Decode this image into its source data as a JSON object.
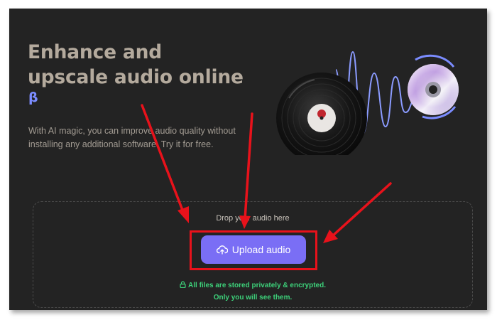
{
  "hero": {
    "title_line1": "Enhance and",
    "title_line2": "upscale audio online",
    "beta_badge": "β",
    "subtitle": "With AI magic, you can improve audio quality without installing any additional software. Try it for free."
  },
  "dropzone": {
    "hint": "Drop your audio here",
    "upload_button_label": "Upload audio",
    "privacy_line1": "All files are stored privately & encrypted.",
    "privacy_line2": "Only you will see them."
  },
  "icons": {
    "upload": "cloud-upload-icon",
    "privacy": "lock-icon",
    "vinyl": "vinyl-record-icon",
    "cd": "compact-disc-icon",
    "waveform": "waveform-icon"
  },
  "colors": {
    "background": "#232323",
    "accent": "#7a6ef5",
    "title": "#b4aa9d",
    "beta": "#7b8cff",
    "privacy_text": "#3dd17a",
    "annotation": "#e8121b"
  }
}
